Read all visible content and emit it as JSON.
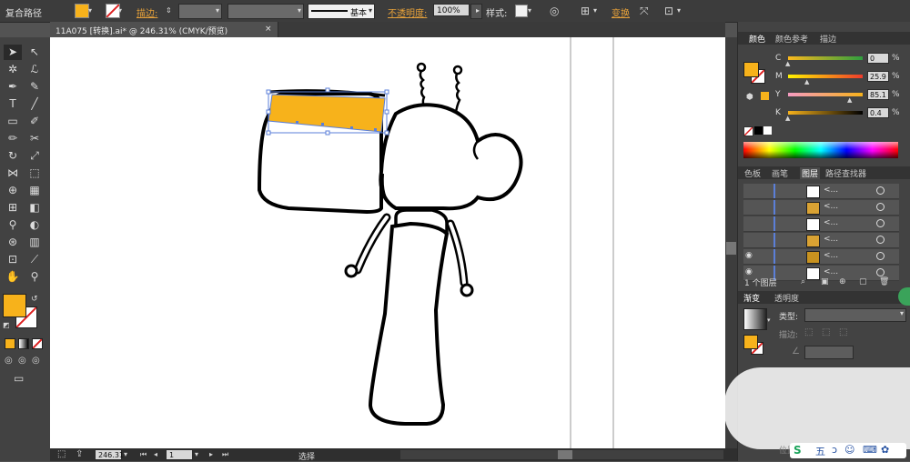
{
  "control_bar": {
    "selection_label": "复合路径",
    "stroke_label": "描边:",
    "stroke_style_label": "基本",
    "opacity_label": "不透明度:",
    "opacity_value": "100%",
    "style_label": "样式:",
    "transform_label": "变换",
    "fill_color": "#f7b21b"
  },
  "document_tab": {
    "title": "11A075 [转换].ai* @ 246.31% (CMYK/预览)",
    "close": "×"
  },
  "color_panel": {
    "tabs": [
      "颜色",
      "颜色参考",
      "描边"
    ],
    "fill_color": "#f7b21b",
    "sliders": [
      {
        "label": "C",
        "value": "0",
        "unit": "%",
        "fraction": 0.0
      },
      {
        "label": "M",
        "value": "25.9",
        "unit": "%",
        "fraction": 0.259
      },
      {
        "label": "Y",
        "value": "85.1",
        "unit": "%",
        "fraction": 0.851
      },
      {
        "label": "K",
        "value": "0.4",
        "unit": "%",
        "fraction": 0.004
      }
    ]
  },
  "layers_panel": {
    "tabs": [
      "色板",
      "画笔",
      "图层",
      "路径查找器"
    ],
    "rows": [
      {
        "name": "<...",
        "visible": false
      },
      {
        "name": "<...",
        "visible": false
      },
      {
        "name": "<...",
        "visible": false
      },
      {
        "name": "<...",
        "visible": false
      },
      {
        "name": "<...",
        "visible": true
      },
      {
        "name": "<...",
        "visible": true
      }
    ],
    "footer": "1 个图层"
  },
  "gradient_panel": {
    "tabs": [
      "渐变",
      "透明度"
    ],
    "type_label": "类型:",
    "stroke_label": "描边:"
  },
  "status_bar": {
    "zoom": "246.31",
    "page": "1",
    "tool": "选择"
  },
  "overlay": {
    "position_label": "位置"
  }
}
